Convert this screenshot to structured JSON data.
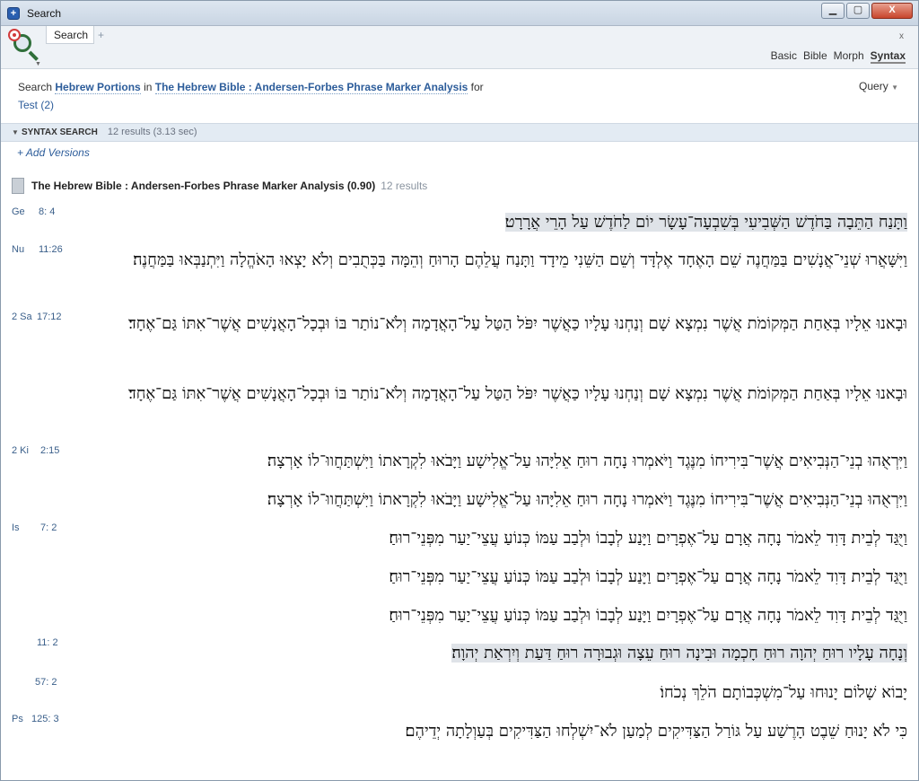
{
  "window": {
    "title": "Search",
    "buttons": {
      "minimize": "▁",
      "maximize": "▢",
      "close": "X"
    }
  },
  "toolbar": {
    "tab_label": "Search",
    "plus": "+",
    "close_x": "x",
    "modes": [
      "Basic",
      "Bible",
      "Morph",
      "Syntax"
    ],
    "active_mode": "Syntax"
  },
  "query": {
    "prefix": "Search",
    "scope": "Hebrew Portions",
    "in": "in",
    "bible": "The Hebrew Bible : Andersen-Forbes Phrase Marker Analysis",
    "for": "for",
    "term": "Test (2)",
    "query_button": "Query"
  },
  "results_bar": {
    "label": "SYNTAX SEARCH",
    "count": "12 results (3.13 sec)"
  },
  "add_versions": "+ Add Versions",
  "version": {
    "title": "The Hebrew Bible : Andersen-Forbes Phrase Marker Analysis (0.90)",
    "count": "12 results"
  },
  "results": [
    {
      "book": "Ge",
      "ref": "8:  4",
      "text": "וַתָּנַח הַתֵּבָה בַּחֹדֶשׁ הַשְּׁבִיעִי בְּשִׁבְעָה־עָשָׂר יוֹם לַחֹדֶשׁ עַל הָרֵי אֲרָרָט׃"
    },
    {
      "book": "Nu",
      "ref": "11:26",
      "text": "וַיִּשָּׁאֲרוּ שְׁנֵי־אֲנָשִׁים בַּמַּחֲנֶה שֵׁם הָאֶחָד אֶלְדָּד וְשֵׁם הַשֵּׁנִי מֵידָד וַתָּנַח עֲלֵהֶם הָרוּחַ וְהֵמָּה בַּכְּתֻבִים וְלֹא יָצְאוּ הָאֹהֱלָה וַיִּתְנַבְּאוּ בַּמַּחֲנֶה׃"
    },
    {
      "book": "2 Sa",
      "ref": "17:12",
      "text": "וּבָאנוּ אֵלָיו בְּאַחַת הַמְּקוֹמֹת אֲשֶׁר נִמְצָא שָׁם וְנַחְנוּ עָלָיו כַּאֲשֶׁר יִפֹּל הַטַּל עַל־הָאֲדָמָה וְלֹא־נוֹתַר בּוֹ וּבְכָל־הָאֲנָשִׁים אֲשֶׁר־אִתּוֹ גַּם־אֶחָד׃"
    },
    {
      "book": "",
      "ref": "",
      "text": "וּבָאנוּ אֵלָיו בְּאַחַת הַמְּקוֹמֹת אֲשֶׁר נִמְצָא שָׁם וְנַחְנוּ עָלָיו כַּאֲשֶׁר יִפֹּל הַטַּל עַל־הָאֲדָמָה וְלֹא־נוֹתַר בּוֹ וּבְכָל־הָאֲנָשִׁים אֲשֶׁר־אִתּוֹ גַּם־אֶחָד׃"
    },
    {
      "book": "2 Ki",
      "ref": "2:15",
      "text": "וַיִּרְאֻהוּ בְנֵי־הַנְּבִיאִים אֲשֶׁר־בִּירִיחוֹ מִנֶּגֶד וַיֹּאמְרוּ נָחָה רוּחַ אֵלִיָּהוּ עַל־אֱלִישָׁע וַיָּבֹאוּ לִקְרָאתוֹ וַיִּשְׁתַּחֲווּ־לוֹ אָרְצָה׃"
    },
    {
      "book": "",
      "ref": "",
      "text": "וַיִּרְאֻהוּ בְנֵי־הַנְּבִיאִים אֲשֶׁר־בִּירִיחוֹ מִנֶּגֶד וַיֹּאמְרוּ נָחָה רוּחַ אֵלִיָּהוּ עַל־אֱלִישָׁע וַיָּבֹאוּ לִקְרָאתוֹ וַיִּשְׁתַּחֲווּ־לוֹ אָרְצָה׃"
    },
    {
      "book": "Is",
      "ref": "7:  2",
      "text": "וַיֻּגַּד לְבֵית דָּוִד לֵאמֹר נָחָה אֲרָם עַל־אֶפְרָיִם וַיָּנַע לְבָבוֹ וּלְבַב עַמּוֹ כְּנוֹעַ עֲצֵי־יַעַר מִפְּנֵי־רוּחַ׃"
    },
    {
      "book": "",
      "ref": "",
      "text": "וַיֻּגַּד לְבֵית דָּוִד לֵאמֹר נָחָה אֲרָם עַל־אֶפְרָיִם וַיָּנַע לְבָבוֹ וּלְבַב עַמּוֹ כְּנוֹעַ עֲצֵי־יַעַר מִפְּנֵי־רוּחַ׃"
    },
    {
      "book": "",
      "ref": "",
      "text": "וַיֻּגַּד לְבֵית דָּוִד לֵאמֹר נָחָה אֲרָם עַל־אֶפְרָיִם וַיָּנַע לְבָבוֹ וּלְבַב עַמּוֹ כְּנוֹעַ עֲצֵי־יַעַר מִפְּנֵי־רוּחַ׃"
    },
    {
      "book": "",
      "ref": "11:  2",
      "text": "וְנָחָה עָלָיו רוּחַ יְהוָה רוּחַ חָכְמָה וּבִינָה רוּחַ עֵצָה וּגְבוּרָה רוּחַ דַּעַת וְיִרְאַת יְהוָה׃"
    },
    {
      "book": "",
      "ref": "57:  2",
      "text": "יָבוֹא שָׁלוֹם יָנוּחוּ עַל־מִשְׁכְּבוֹתָם הֹלֵךְ נְכֹחוֹ׃"
    },
    {
      "book": "Ps",
      "ref": "125:  3",
      "text": "כִּי לֹא יָנוּחַ שֵׁבֶט הָרֶשַׁע עַל גּוֹרַל הַצַּדִּיקִים לְמַעַן לֹא־יִשְׁלְחוּ הַצַּדִּיקִים בְּעַוְלָתָה יְדֵיהֶם׃"
    }
  ]
}
